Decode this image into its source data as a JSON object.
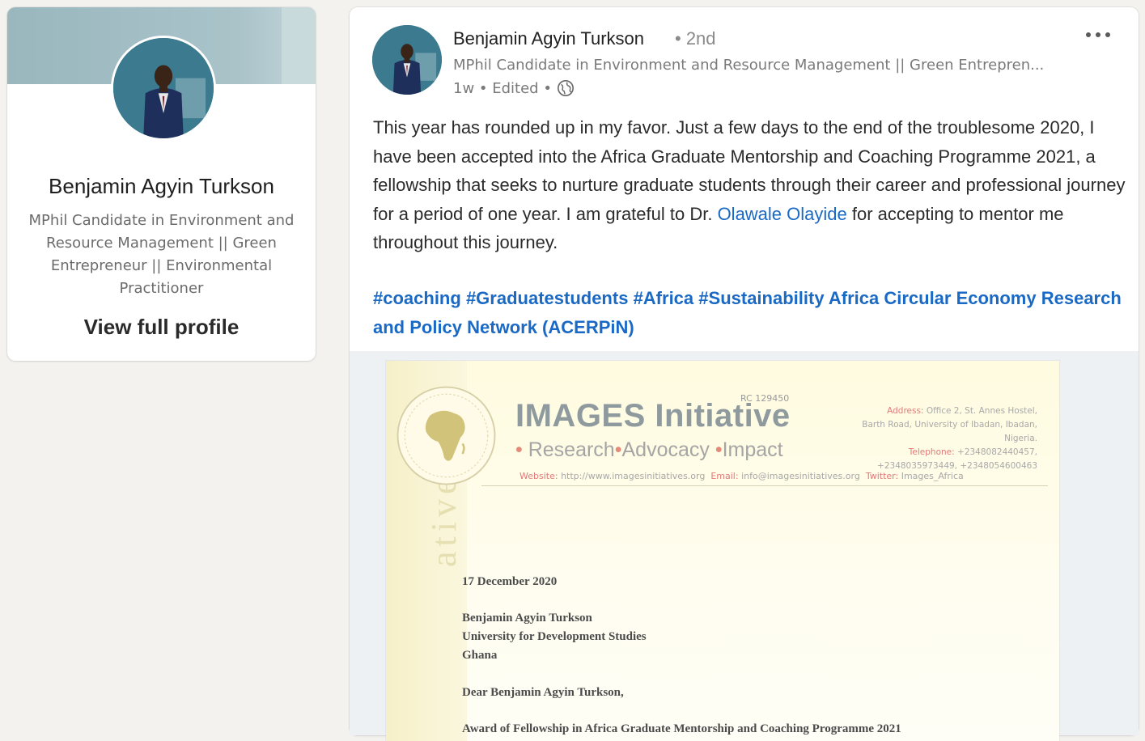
{
  "sidebar": {
    "name": "Benjamin Agyin Turkson",
    "headline": "MPhil Candidate in Environment and Resource Management || Green Entrepreneur || Environmental Practitioner",
    "view_profile": "View full profile"
  },
  "post": {
    "author": "Benjamin Agyin Turkson",
    "degree": "• 2nd",
    "headline": "MPhil Candidate in Environment and Resource Management || Green Entrepren...",
    "meta": "1w • Edited •",
    "body_before": "This year has rounded up in my favor. Just a few days to the end of the troublesome 2020, I have been accepted into the Africa Graduate Mentorship and Coaching Programme 2021, a fellowship that seeks to nurture graduate students through their career and professional journey for a period of one year. I am grateful to Dr. ",
    "mention": "Olawale Olayide",
    "body_after": " for accepting to mentor me throughout this journey.",
    "hashtags": [
      "#coaching",
      "#Graduatestudents",
      "#Africa",
      "#Sustainability",
      "Africa Circular Economy Research and Policy Network (ACERPiN)"
    ]
  },
  "letter": {
    "org_name": "IMAGES Initiative",
    "rc": "RC 129450",
    "tag_research": "Research",
    "tag_advocacy": "Advocacy",
    "tag_impact": "Impact",
    "address_label": "Address:",
    "address_1": "Office 2, St. Annes Hostel,",
    "address_2": "Barth Road, University of Ibadan, Ibadan, Nigeria.",
    "telephone_label": "Telephone:",
    "telephone_1": "+2348082440457,",
    "telephone_2": "+2348035973449, +2348054600463",
    "website_label": "Website:",
    "website": "http://www.imagesinitiatives.org",
    "email_label": "Email:",
    "email": "info@imagesinitiatives.org",
    "twitter_label": "Twitter:",
    "twitter": "Images_Africa",
    "watermark": "ative",
    "date": "17 December 2020",
    "recipient_name": "Benjamin Agyin Turkson",
    "recipient_org": "University for Development Studies",
    "recipient_country": "Ghana",
    "salutation": "Dear Benjamin Agyin Turkson,",
    "subject": "Award of Fellowship in Africa Graduate Mentorship and Coaching Programme 2021"
  },
  "colors": {
    "link": "#1a69c4",
    "banner": "#9ab7be"
  },
  "icons": [
    "globe-icon",
    "more-options-icon",
    "africa-seal-icon"
  ]
}
